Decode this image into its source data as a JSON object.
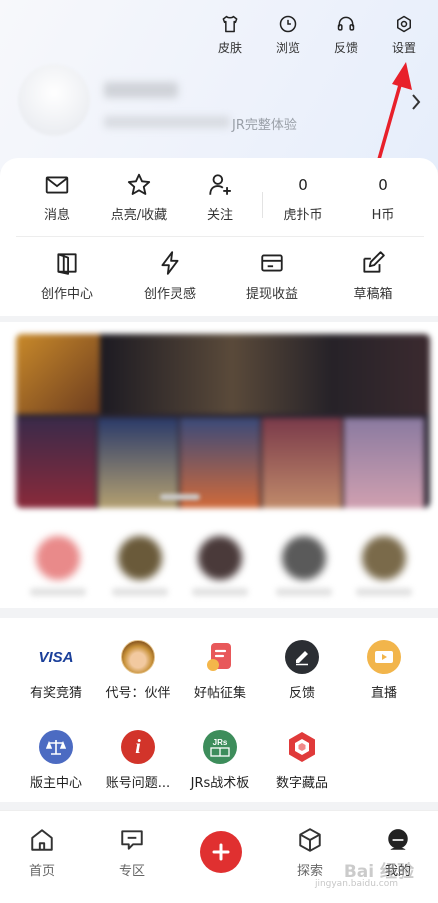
{
  "colors": {
    "accent_red": "#e03030",
    "visa_blue": "#1a3f9a",
    "feedback_dark": "#2b2e33",
    "live_yellow": "#f2b54b",
    "admin_blue": "#4c6bc2",
    "account_red": "#d2342a",
    "jrs_green": "#3d8d5b"
  },
  "top_actions": [
    {
      "label": "皮肤",
      "icon": "shirt-icon"
    },
    {
      "label": "浏览",
      "icon": "clock-icon"
    },
    {
      "label": "反馈",
      "icon": "headset-icon"
    },
    {
      "label": "设置",
      "icon": "gear-icon"
    }
  ],
  "profile": {
    "slogan_suffix": "JR完整体验"
  },
  "stats": {
    "messages": {
      "label": "消息",
      "icon": "mail-icon"
    },
    "likes": {
      "label": "点亮/收藏",
      "icon": "star-icon"
    },
    "follow": {
      "label": "关注",
      "icon": "add-user-icon"
    },
    "hupu_coin": {
      "value": "0",
      "label": "虎扑币"
    },
    "h_coin": {
      "value": "0",
      "label": "H币"
    }
  },
  "creator": [
    {
      "label": "创作中心",
      "icon": "book-icon"
    },
    {
      "label": "创作灵感",
      "icon": "lightning-icon"
    },
    {
      "label": "提现收益",
      "icon": "wallet-icon"
    },
    {
      "label": "草稿箱",
      "icon": "edit-icon"
    }
  ],
  "grid": {
    "row1": [
      {
        "label": "有奖竞猜",
        "icon": "visa-icon",
        "badge": "VISA"
      },
      {
        "label": "代号：伙伴",
        "icon": "avatar-luffy-icon"
      },
      {
        "label": "好帖征集",
        "icon": "coupon-icon"
      },
      {
        "label": "反馈",
        "icon": "pencil-icon"
      },
      {
        "label": "直播",
        "icon": "video-icon"
      }
    ],
    "row2": [
      {
        "label": "版主中心",
        "icon": "scale-icon"
      },
      {
        "label": "账号问题...",
        "icon": "info-icon",
        "glyph": "i"
      },
      {
        "label": "JRs战术板",
        "icon": "tactics-board-icon",
        "glyph": "JRs"
      },
      {
        "label": "数字藏品",
        "icon": "gem-icon"
      }
    ]
  },
  "nav": {
    "home": {
      "label": "首页",
      "icon": "home-icon"
    },
    "zone": {
      "label": "专区",
      "icon": "chat-icon"
    },
    "post": {
      "icon": "plus-icon"
    },
    "explore": {
      "label": "探索",
      "icon": "cube-icon"
    },
    "mine": {
      "label": "我的",
      "icon": "user-face-icon"
    }
  },
  "watermark": {
    "text": "Bai 经验",
    "url": "jingyan.baidu.com"
  }
}
